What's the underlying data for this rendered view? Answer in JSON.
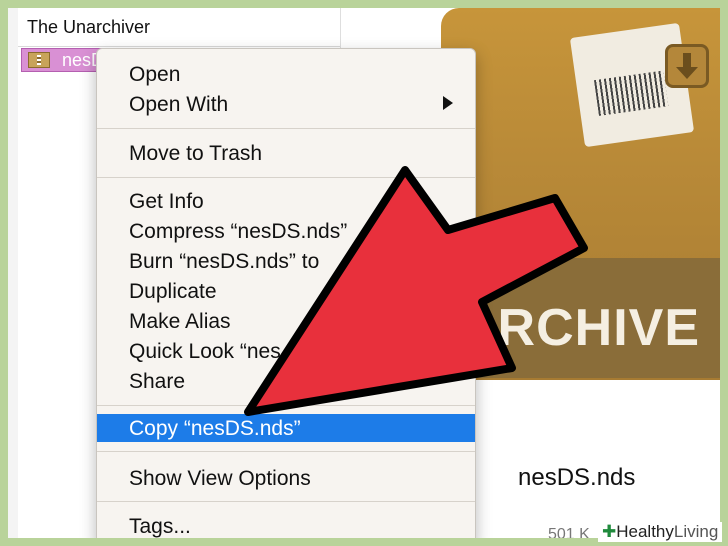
{
  "finder": {
    "header": "The Unarchiver",
    "selected_file": "nesDS.nds",
    "selected_file_visible": "nesD"
  },
  "menu": {
    "items": [
      {
        "label": "Open"
      },
      {
        "label": "Open With",
        "has_submenu": true
      },
      {
        "label": "Move to Trash"
      },
      {
        "label": "Get Info"
      },
      {
        "label": "Compress “nesDS.nds”"
      },
      {
        "label": "Burn “nesDS.nds” to"
      },
      {
        "label": "Duplicate"
      },
      {
        "label": "Make Alias"
      },
      {
        "label": "Quick Look “nes"
      },
      {
        "label": "Share"
      },
      {
        "label": "Copy “nesDS.nds”",
        "highlighted": true
      },
      {
        "label": "Show View Options"
      },
      {
        "label": "Tags..."
      }
    ]
  },
  "preview": {
    "archive_text": "ARCHIVE",
    "filename": "nesDS.nds",
    "size_partial": "501 K"
  },
  "watermark": {
    "cross": "✚",
    "healthy": "Healthy",
    "living": "Living"
  },
  "colors": {
    "highlight": "#1d7ce8",
    "arrow": "#e8303c",
    "arrow_outline": "#000000",
    "border": "#b9d39a",
    "selection": "#d990d4"
  }
}
